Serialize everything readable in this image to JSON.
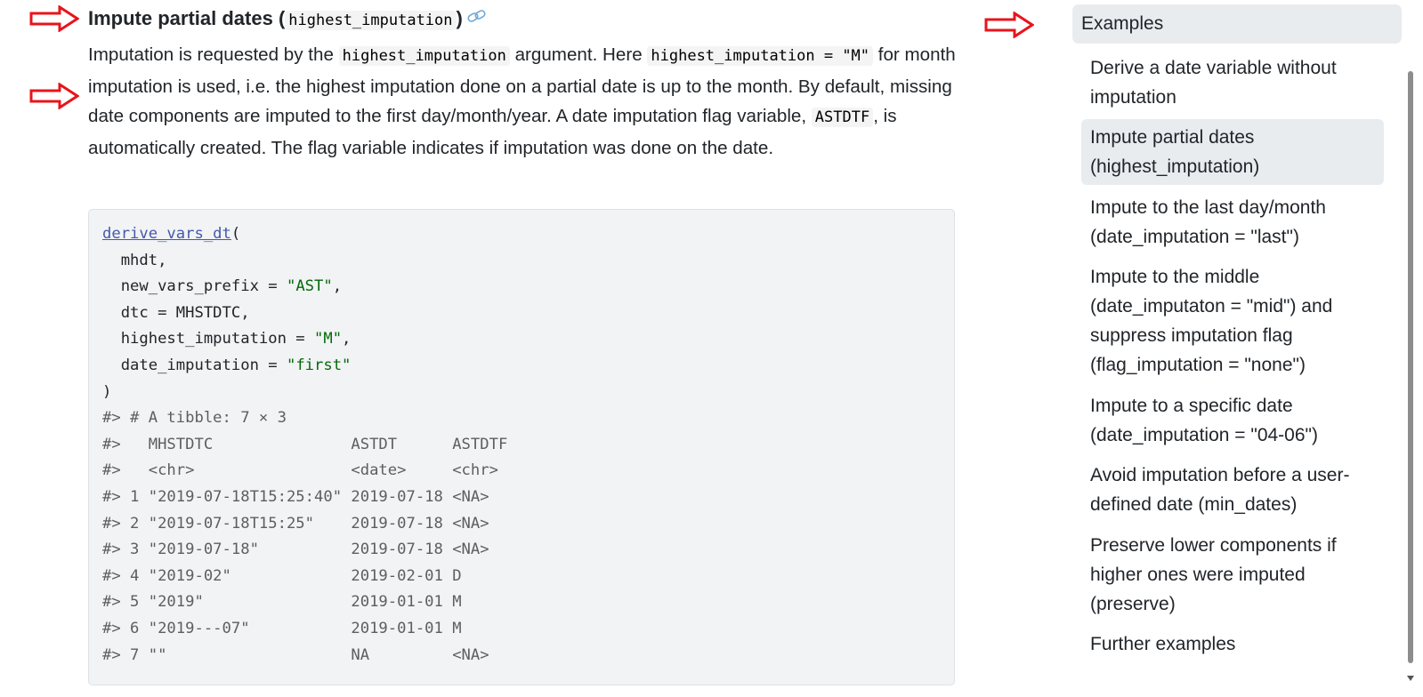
{
  "main": {
    "heading_text": "Impute partial dates (",
    "heading_code": "highest_imputation",
    "heading_end": ")",
    "para": {
      "t1": "Imputation is requested by the ",
      "c1": "highest_imputation",
      "t2": " argument. Here ",
      "c2": "highest_imputation = \"M\"",
      "t3": " for month imputation is used, i.e. the highest imputation done on a partial date is up to the month. By default, missing date components are imputed to the first day/month/year. A date imputation flag variable, ",
      "c3": "ASTDTF",
      "t4": ", is automatically created. The flag variable indicates if imputation was done on the date."
    },
    "code": {
      "fn": "derive_vars_dt",
      "open_paren": "(",
      "arg1": "  mhdt,",
      "arg2_key": "  new_vars_prefix = ",
      "arg2_val": "\"AST\"",
      "arg2_end": ",",
      "arg3": "  dtc = MHSTDTC,",
      "arg4_key": "  highest_imputation = ",
      "arg4_val": "\"M\"",
      "arg4_end": ",",
      "arg5_key": "  date_imputation = ",
      "arg5_val": "\"first\"",
      "close_paren": ")",
      "output": [
        "#> # A tibble: 7 × 3",
        "#>   MHSTDTC               ASTDT      ASTDTF",
        "#>   <chr>                 <date>     <chr> ",
        "#> 1 \"2019-07-18T15:25:40\" 2019-07-18 <NA>  ",
        "#> 2 \"2019-07-18T15:25\"    2019-07-18 <NA>  ",
        "#> 3 \"2019-07-18\"          2019-07-18 <NA>  ",
        "#> 4 \"2019-02\"             2019-02-01 D     ",
        "#> 5 \"2019\"                2019-01-01 M     ",
        "#> 6 \"2019---07\"           2019-01-01 M     ",
        "#> 7 \"\"                    NA         <NA>  "
      ]
    }
  },
  "toc": {
    "header": "Examples",
    "items": [
      "Derive a date variable without imputation",
      "Impute partial dates (highest_imputation)",
      "Impute to the last day/month (date_imputation = \"last\")",
      "Impute to the middle (date_imputaton = \"mid\") and suppress imputation flag (flag_imputation = \"none\")",
      "Impute to a specific date (date_imputation = \"04-06\")",
      "Avoid imputation before a user-defined date (min_dates)",
      "Preserve lower components if higher ones were imputed (preserve)",
      "Further examples"
    ]
  },
  "annotations": {
    "arrow_color": "#e8141b",
    "arrow_icon": "arrow-right-outline-icon"
  },
  "colors": {
    "code_bg": "#f1f3f5",
    "function_link": "#4758ab",
    "string": "#036a07",
    "toc_active_bg": "#e9ecef"
  }
}
